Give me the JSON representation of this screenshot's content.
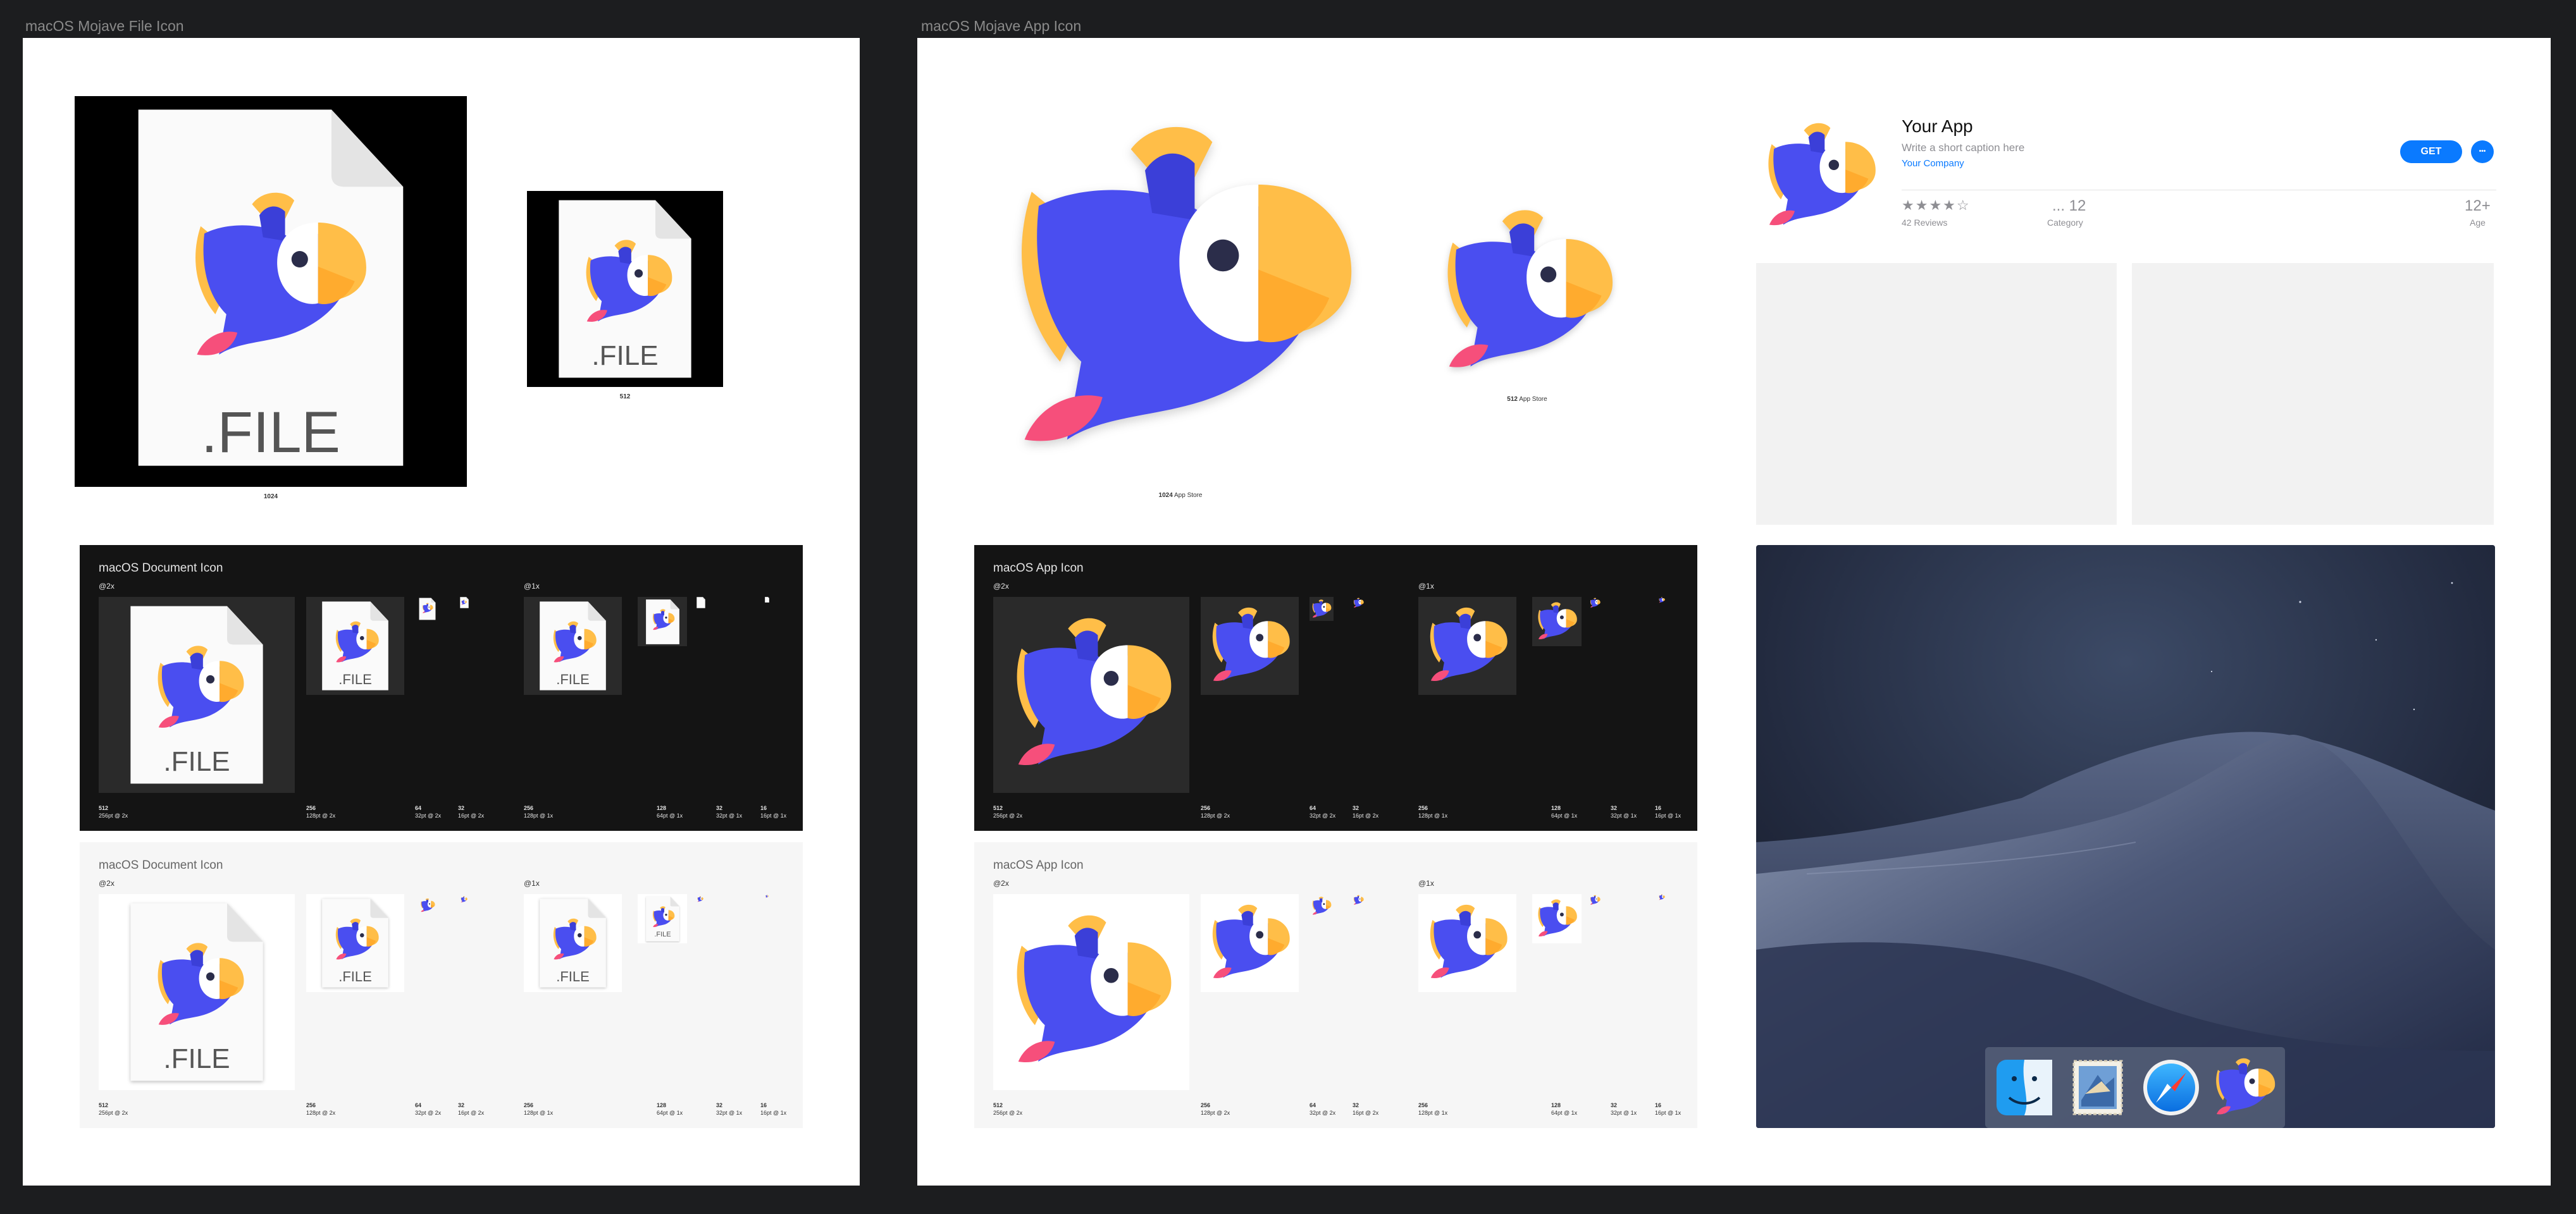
{
  "artboards": {
    "file_icon": {
      "label": "macOS Mojave File Icon"
    },
    "app_icon": {
      "label": "macOS Mojave App Icon"
    }
  },
  "file_hero": {
    "ext": ".FILE",
    "caption_large": "1024",
    "caption_small": "512"
  },
  "app_hero": {
    "caption_large": {
      "size": "1024",
      "label": "App Store"
    },
    "caption_small": {
      "size": "512",
      "label": "App Store"
    }
  },
  "doc_dark": {
    "title": "macOS Document Icon",
    "scale_2x": "@2x",
    "scale_1x": "@1x",
    "ext": ".FILE",
    "tiles": [
      {
        "size": "512",
        "sub": "256pt @ 2x"
      },
      {
        "size": "256",
        "sub": "128pt @ 2x"
      },
      {
        "size": "64",
        "sub": "32pt @ 2x"
      },
      {
        "size": "32",
        "sub": "16pt @ 2x"
      },
      {
        "size": "256",
        "sub": "128pt @ 1x"
      },
      {
        "size": "128",
        "sub": "64pt @ 1x"
      },
      {
        "size": "32",
        "sub": "32pt @ 1x"
      },
      {
        "size": "16",
        "sub": "16pt @ 1x"
      }
    ]
  },
  "doc_light": {
    "title": "macOS Document Icon",
    "scale_2x": "@2x",
    "scale_1x": "@1x",
    "ext": ".FILE",
    "tiles": [
      {
        "size": "512",
        "sub": "256pt @ 2x"
      },
      {
        "size": "256",
        "sub": "128pt @ 2x"
      },
      {
        "size": "64",
        "sub": "32pt @ 2x"
      },
      {
        "size": "32",
        "sub": "16pt @ 2x"
      },
      {
        "size": "256",
        "sub": "128pt @ 1x"
      },
      {
        "size": "128",
        "sub": "64pt @ 1x"
      },
      {
        "size": "32",
        "sub": "32pt @ 1x"
      },
      {
        "size": "16",
        "sub": "16pt @ 1x"
      }
    ]
  },
  "app_dark": {
    "title": "macOS App Icon",
    "scale_2x": "@2x",
    "scale_1x": "@1x",
    "tiles": [
      {
        "size": "512",
        "sub": "256pt @ 2x"
      },
      {
        "size": "256",
        "sub": "128pt @ 2x"
      },
      {
        "size": "64",
        "sub": "32pt @ 2x"
      },
      {
        "size": "32",
        "sub": "16pt @ 2x"
      },
      {
        "size": "256",
        "sub": "128pt @ 1x"
      },
      {
        "size": "128",
        "sub": "64pt @ 1x"
      },
      {
        "size": "32",
        "sub": "32pt @ 1x"
      },
      {
        "size": "16",
        "sub": "16pt @ 1x"
      }
    ]
  },
  "app_light": {
    "title": "macOS App Icon",
    "scale_2x": "@2x",
    "scale_1x": "@1x",
    "tiles": [
      {
        "size": "512",
        "sub": "256pt @ 2x"
      },
      {
        "size": "256",
        "sub": "128pt @ 2x"
      },
      {
        "size": "64",
        "sub": "32pt @ 2x"
      },
      {
        "size": "32",
        "sub": "16pt @ 2x"
      },
      {
        "size": "256",
        "sub": "128pt @ 1x"
      },
      {
        "size": "128",
        "sub": "64pt @ 1x"
      },
      {
        "size": "32",
        "sub": "32pt @ 1x"
      },
      {
        "size": "16",
        "sub": "16pt @ 1x"
      }
    ]
  },
  "app_store": {
    "name": "Your App",
    "caption": "Write a short caption here",
    "company": "Your Company",
    "get_label": "GET",
    "more_label": "•••",
    "rating_stars": "★★★★☆",
    "rating_value": 4,
    "reviews": "42 Reviews",
    "category_value": "... 12",
    "category_label": "Category",
    "age_value": "12+",
    "age_label": "Age",
    "accent": "#0a7aff"
  },
  "dock": {
    "apps": [
      "finder-icon",
      "mail-stamp-icon",
      "safari-compass-icon",
      "parrot-app-icon"
    ]
  },
  "colors": {
    "bird_blue": "#4a4ef0",
    "beak_yellow": "#ffbe48",
    "beak_orange": "#ffab2e",
    "tail_pink": "#f64f7b",
    "eye_dark": "#2b2d4a"
  }
}
